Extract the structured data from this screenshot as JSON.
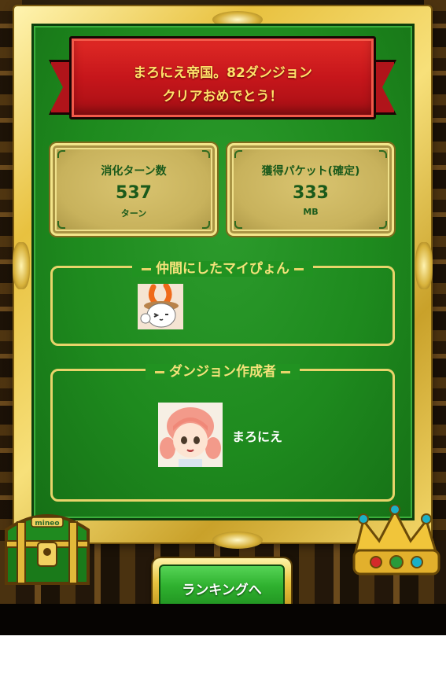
{
  "banner": {
    "line1": "まろにえ帝国。82ダンジョン",
    "line2": "クリアおめでとう！"
  },
  "stats": {
    "turns": {
      "label": "消化ターン数",
      "value": "537",
      "unit": "ターン"
    },
    "packets": {
      "label": "獲得パケット(確定)",
      "value": "333",
      "unit": "MB"
    }
  },
  "companions": {
    "title": "仲間にしたマイぴょん",
    "items": [
      {
        "icon": "rabbit-avatar"
      }
    ]
  },
  "creator": {
    "title": "ダンジョン作成者",
    "name": "まろにえ",
    "icon": "girl-avatar"
  },
  "chest": {
    "label": "mineo"
  },
  "actions": {
    "ranking_label": "ランキングへ"
  },
  "colors": {
    "board_green": "#219221",
    "banner_red": "#c6161b",
    "banner_text": "#ffe36a",
    "gold": "#e8c13f",
    "stat_text": "#1b5a1b",
    "button_green": "#2fb12f"
  }
}
